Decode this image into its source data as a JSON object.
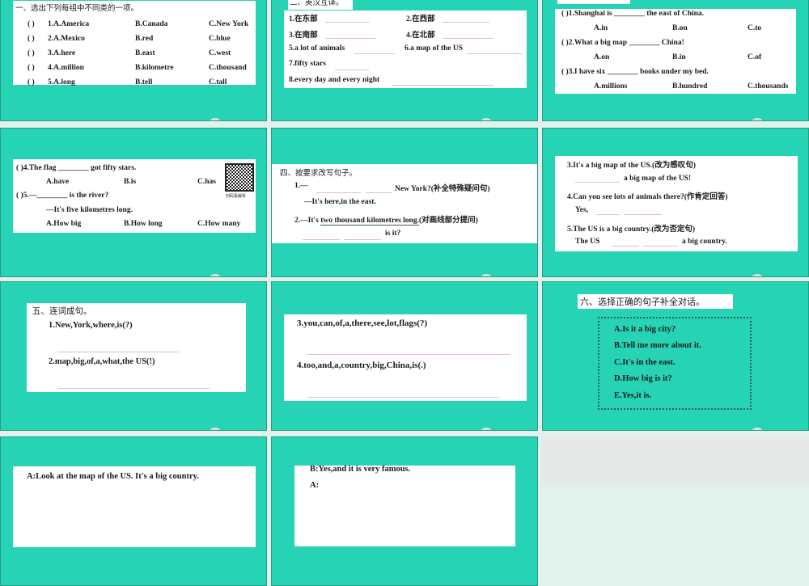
{
  "slide1": {
    "title": "一、选出下列每组中不同类的一项。",
    "rows": [
      {
        "p": "(    )",
        "a": "1.A.America",
        "b": "B.Canada",
        "c": "C.New York"
      },
      {
        "p": "(    )",
        "a": "2.A.Mexico",
        "b": "B.red",
        "c": "C.blue"
      },
      {
        "p": "(    )",
        "a": "3.A.here",
        "b": "B.east",
        "c": "C.west"
      },
      {
        "p": "(    )",
        "a": "4.A.million",
        "b": "B.kilometre",
        "c": "C.thousand"
      },
      {
        "p": "(    )",
        "a": "5.A.long",
        "b": "B.tell",
        "c": "C.tall"
      }
    ]
  },
  "slide2": {
    "title": "二、英汉互译。",
    "items": [
      "1.在东部",
      "2.在西部",
      "3.在南部",
      "4.在北部",
      "5.a lot of animals",
      "6.a map of the US",
      "7.fifty stars",
      "8.every day and every night"
    ]
  },
  "slide3": {
    "q1": "(      )1.Shanghai is ________ the east of China.",
    "q1o": [
      "A.in",
      "B.on",
      "C.to"
    ],
    "q2": "(      )2.What a big map ________ China!",
    "q2o": [
      "A.on",
      "B.in",
      "C.of"
    ],
    "q3": "(      )3.I have six ________ books under my bed.",
    "q3o": [
      "A.millions",
      "B.hundred",
      "C.thousands"
    ]
  },
  "slide4": {
    "q4": "(      )4.The flag ________ got fifty stars.",
    "q4o": [
      "A.have",
      "B.is",
      "C.has"
    ],
    "q5": "(      )5.—________ is the river?",
    "q5a": "—It's five kilometres long.",
    "q5o": [
      "A.How big",
      "B.How long",
      "C.How many"
    ],
    "qr_caption": "扫码看解析"
  },
  "slide5": {
    "title": "四、按要求改写句子。",
    "l1": "1.—",
    "l1b": "New York?(补全特殊疑问句)",
    "l2": "—It's here,in the east.",
    "l3a": "2.—It's ",
    "l3u": "two thousand kilometres long.",
    "l3b": "(对画线部分提问)",
    "l4": "is it?"
  },
  "slide6": {
    "l1": "3.It's a big map of the US.(改为感叹句)",
    "l2": "a big map of the US!",
    "l3": "4.Can you see lots of animals there?(作肯定回答)",
    "l4": "Yes,",
    "l5": "5.The US is a big country.(改为否定句)",
    "l6a": "The US",
    "l6b": "a big country."
  },
  "slide7": {
    "title": "五、连词成句。",
    "l1": "1.New,York,where,is(?)",
    "l2": "2.map,big,of,a,what,the US(!)"
  },
  "slide8": {
    "l1": "3.you,can,of,a,there,see,lot,flags(?)",
    "l2": "4.too,and,a,country,big,China,is(.)"
  },
  "slide9": {
    "title": "六、选择正确的句子补全对话。",
    "options": [
      "A.Is it a big city?",
      "B.Tell me more about it.",
      "C.It's in the east.",
      "D.How big is it?",
      "E.Yes,it is."
    ]
  },
  "slide10": {
    "l1": "A:Look at the map of the US. It's a big country."
  },
  "slide11": {
    "l1": "B:Yes,and it is very famous.",
    "l2": "A:"
  }
}
